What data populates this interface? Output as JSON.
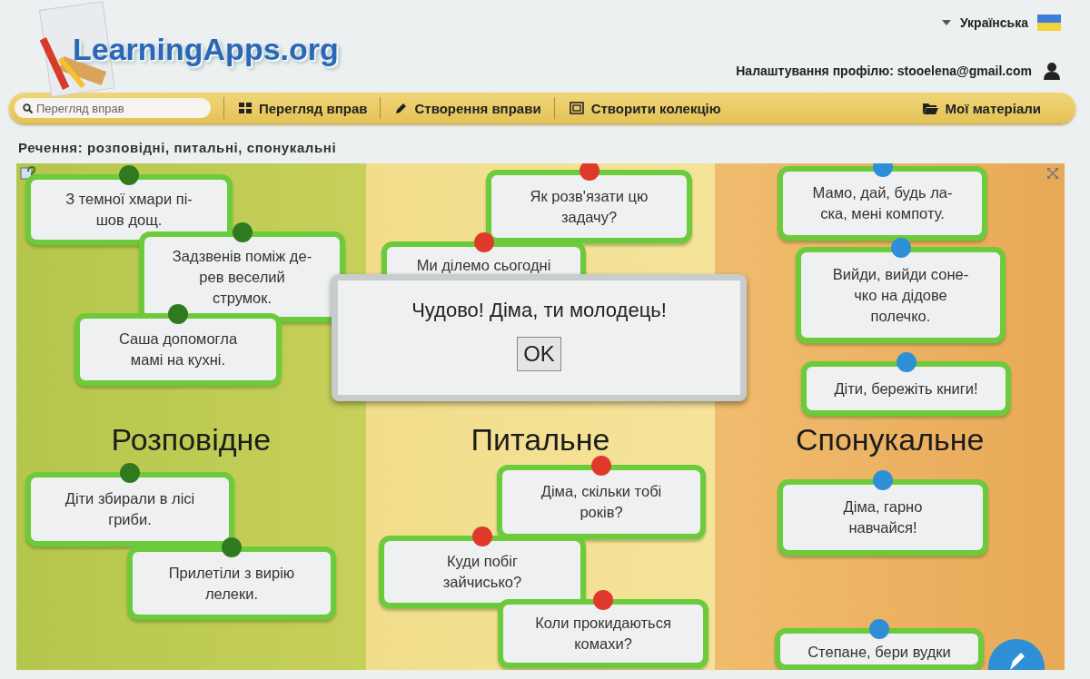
{
  "header": {
    "logo": "LearningApps.org",
    "language": "Українська",
    "profile_label": "Налаштування профілю: stooelena@gmail.com"
  },
  "nav": {
    "search": {
      "placeholder": "Перегляд вправ"
    },
    "items": [
      {
        "label": "Перегляд вправ",
        "kind": "grid"
      },
      {
        "label": "Створення вправи",
        "kind": "pencil"
      },
      {
        "label": "Створити колекцію",
        "kind": "frame"
      },
      {
        "label": "Мої матеріали",
        "kind": "folder"
      }
    ]
  },
  "page_title": "Речення: розповідні, питальні, спонукальні",
  "game": {
    "columns": [
      {
        "title": "Розповідне",
        "cards": [
          {
            "text": "З темної хмари пі-шов дощ.",
            "color": "#2f7a1e"
          },
          {
            "text": "Задзвенів поміж де-рев веселий струмок.",
            "color": "#2f7a1e"
          },
          {
            "text": "Саша допомогла мамі на кухні.",
            "color": "#2f7a1e"
          },
          {
            "text": "Діти збирали в лісі гриби.",
            "color": "#2f7a1e"
          },
          {
            "text": "Прилетіли з вирію лелеки.",
            "color": "#2f7a1e"
          }
        ]
      },
      {
        "title": "Питальне",
        "cards": [
          {
            "text": "Як розв'язати цю задачу?",
            "color": "#e0392b"
          },
          {
            "text": "Ми ділемо сьогодні",
            "color": "#e0392b"
          },
          {
            "text": "Діма, скільки тобі років?",
            "color": "#e0392b"
          },
          {
            "text": "Куди побіг зайчисько?",
            "color": "#e0392b"
          },
          {
            "text": "Коли прокидаються комахи?",
            "color": "#e0392b"
          }
        ]
      },
      {
        "title": "Спонукальне",
        "cards": [
          {
            "text": "Мамо, дай, будь ла-ска, мені компоту.",
            "color": "#2f8fd6"
          },
          {
            "text": "Вийди, вийди соне-чко на дідове полечко.",
            "color": "#2f8fd6"
          },
          {
            "text": "Діти, бережіть книги!",
            "color": "#2f8fd6"
          },
          {
            "text": "Діма, гарно навчайся!",
            "color": "#2f8fd6"
          },
          {
            "text": "Степане, бери вудки",
            "color": "#2f8fd6"
          }
        ]
      }
    ]
  },
  "dialog": {
    "message": "Чудово! Діма, ти молодець!",
    "button": "OK"
  }
}
